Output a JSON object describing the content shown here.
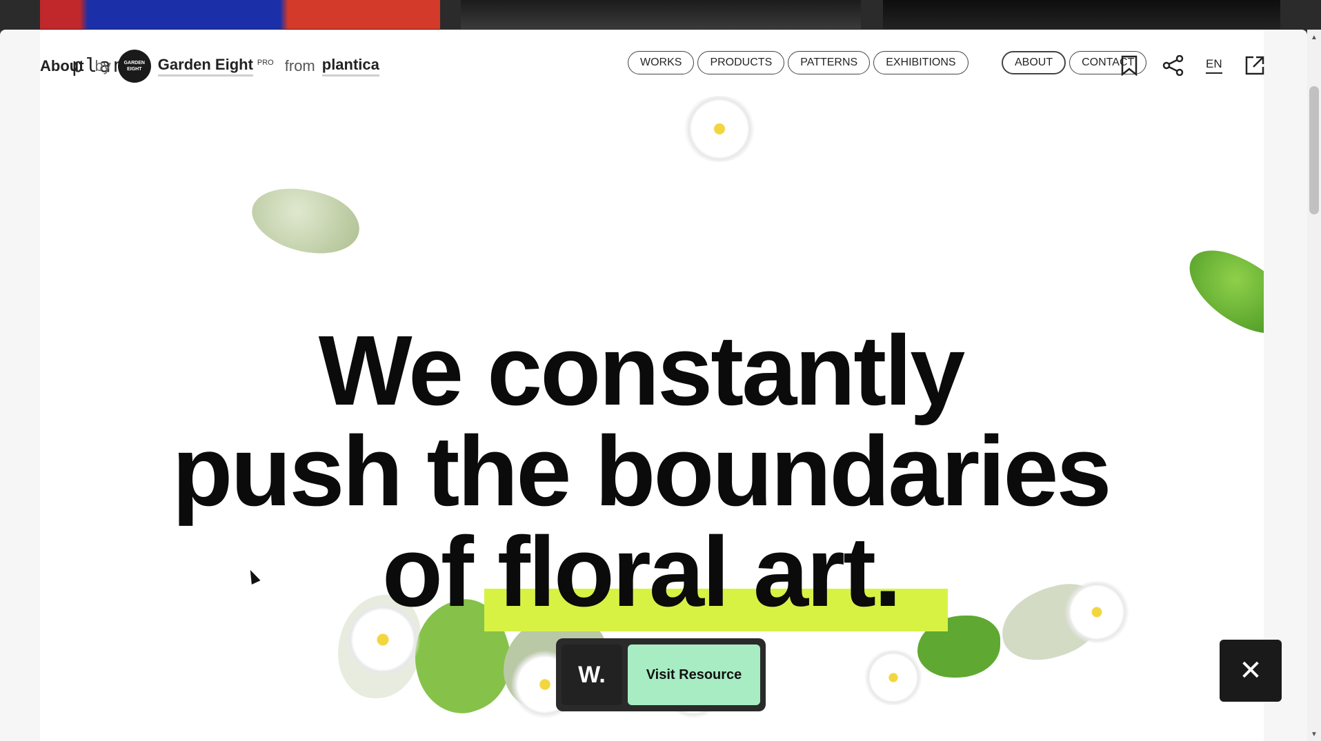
{
  "header": {
    "about_label": "About",
    "by_label": "by",
    "ghost_logo": "plant",
    "avatar_text": "GARDEN EIGHT",
    "author": "Garden Eight",
    "author_badge": "PRO",
    "from_label": "from",
    "site_name": "plantica"
  },
  "nav": {
    "left": [
      "WORKS",
      "PRODUCTS",
      "PATTERNS",
      "EXHIBITIONS"
    ],
    "right": [
      "ABOUT",
      "CONTACT"
    ],
    "lang": "EN"
  },
  "headline": {
    "line1": "We constantly",
    "line2": "push the boundaries",
    "line3": "of floral art."
  },
  "icons": {
    "bookmark": "bookmark-icon",
    "share": "share-icon",
    "external": "external-link-icon",
    "close": "close-icon"
  },
  "resource": {
    "logo": "W.",
    "visit_label": "Visit Resource"
  },
  "colors": {
    "highlight": "#d8f244",
    "visit_button": "#a8ecc4",
    "dark": "#1a1a1a"
  }
}
